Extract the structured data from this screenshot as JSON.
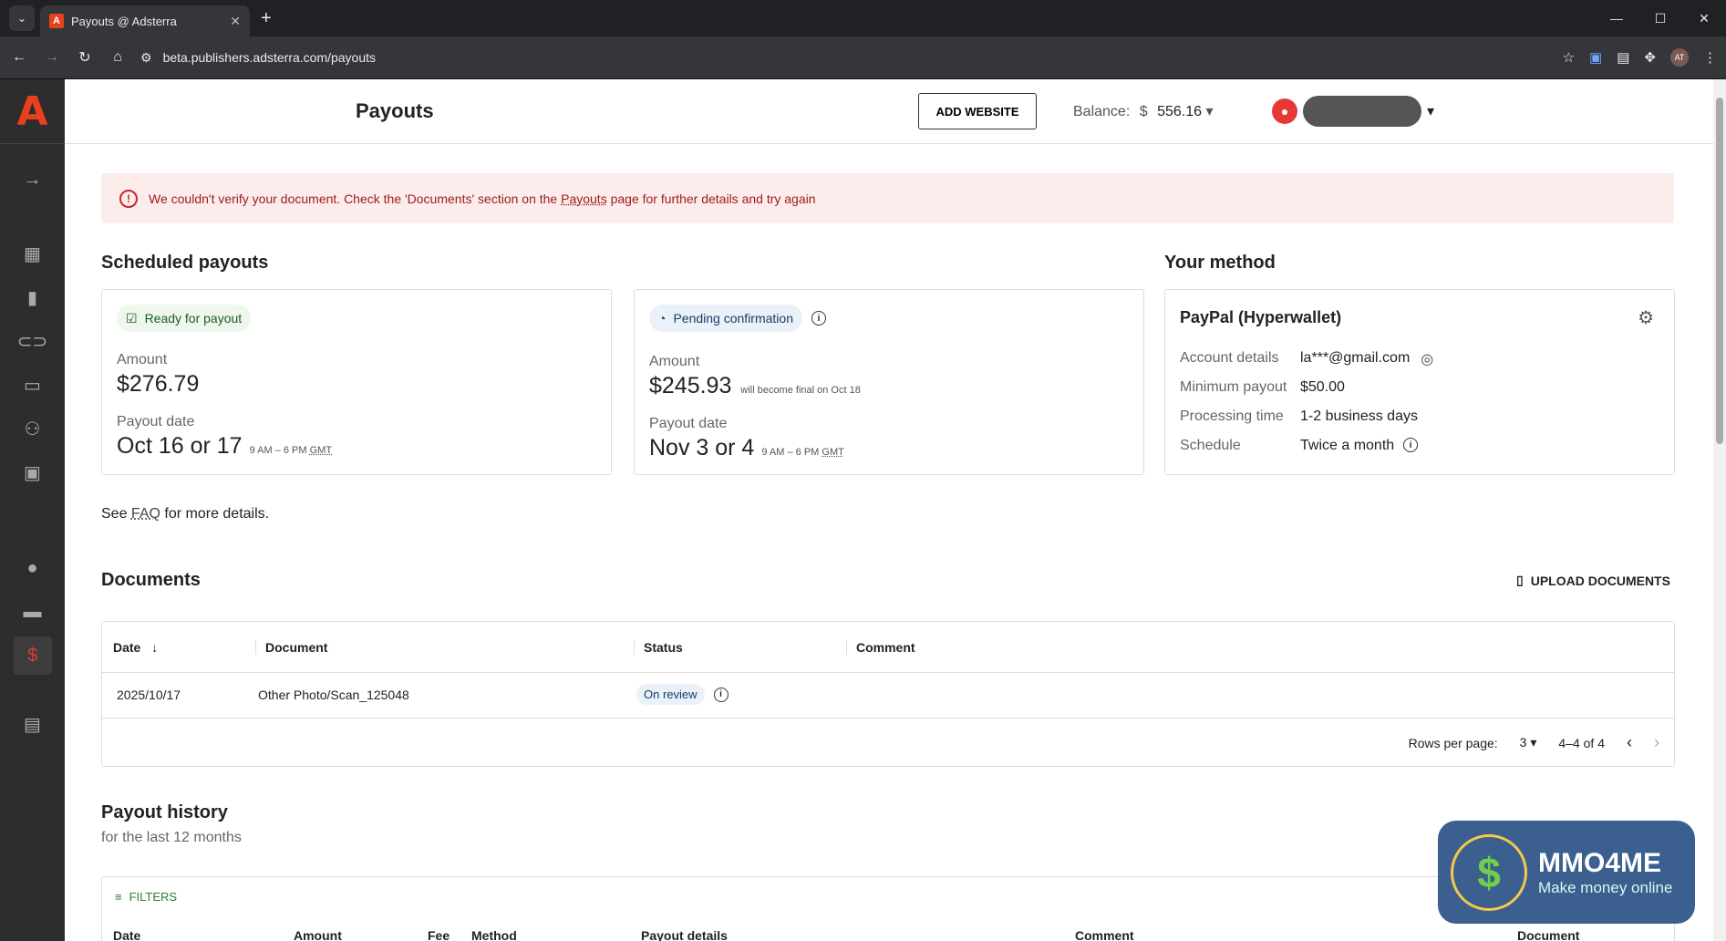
{
  "browser": {
    "tab_title": "Payouts @ Adsterra",
    "tab_favicon": "A",
    "url": "beta.publishers.adsterra.com/payouts",
    "profile_initials": "AT"
  },
  "header": {
    "title": "Payouts",
    "add_website": "ADD WEBSITE",
    "balance_label": "Balance:",
    "balance_currency": "$",
    "balance_value": "556.16"
  },
  "alert": {
    "text_before": "We couldn't verify your document. Check the 'Documents' section on the",
    "link": "Payouts",
    "text_after": "page for further details and try again"
  },
  "scheduled": {
    "heading": "Scheduled payouts",
    "card1": {
      "status": "Ready for payout",
      "amount_label": "Amount",
      "amount": "$276.79",
      "date_label": "Payout date",
      "date": "Oct 16 or 17",
      "time": "9 AM – 6 PM",
      "tz": "GMT"
    },
    "card2": {
      "status": "Pending confirmation",
      "amount_label": "Amount",
      "amount": "$245.93",
      "note": "will become final on Oct 18",
      "date_label": "Payout date",
      "date": "Nov 3 or 4",
      "time": "9 AM – 6 PM",
      "tz": "GMT"
    }
  },
  "method": {
    "heading": "Your method",
    "name": "PayPal (Hyperwallet)",
    "rows": [
      {
        "k": "Account details",
        "v": "la***@gmail.com"
      },
      {
        "k": "Minimum payout",
        "v": "$50.00"
      },
      {
        "k": "Processing time",
        "v": "1-2 business days"
      },
      {
        "k": "Schedule",
        "v": "Twice a month"
      }
    ]
  },
  "faq": {
    "before": "See",
    "link": "FAQ",
    "after": "for more details."
  },
  "documents": {
    "heading": "Documents",
    "upload": "UPLOAD DOCUMENTS",
    "columns": [
      "Date",
      "Document",
      "Status",
      "Comment"
    ],
    "rows": [
      {
        "date": "2025/10/17",
        "document": "Other Photo/Scan_125048",
        "status": "On review",
        "comment": ""
      }
    ],
    "rows_per_page_label": "Rows per page:",
    "rows_per_page": "3",
    "range": "4–4 of 4"
  },
  "history": {
    "heading": "Payout history",
    "sub": "for the last 12 months",
    "filters": "FILTERS",
    "columns": [
      "Date",
      "Amount",
      "Fee",
      "Method",
      "Payout details",
      "Comment",
      "Document"
    ]
  },
  "watermark": {
    "title": "MMO4ME",
    "subtitle": "Make money online",
    "symbol": "$"
  },
  "colors": {
    "accent": "#e8401c",
    "alert_bg": "#fdecec",
    "sidebar": "#2d2d2d"
  }
}
